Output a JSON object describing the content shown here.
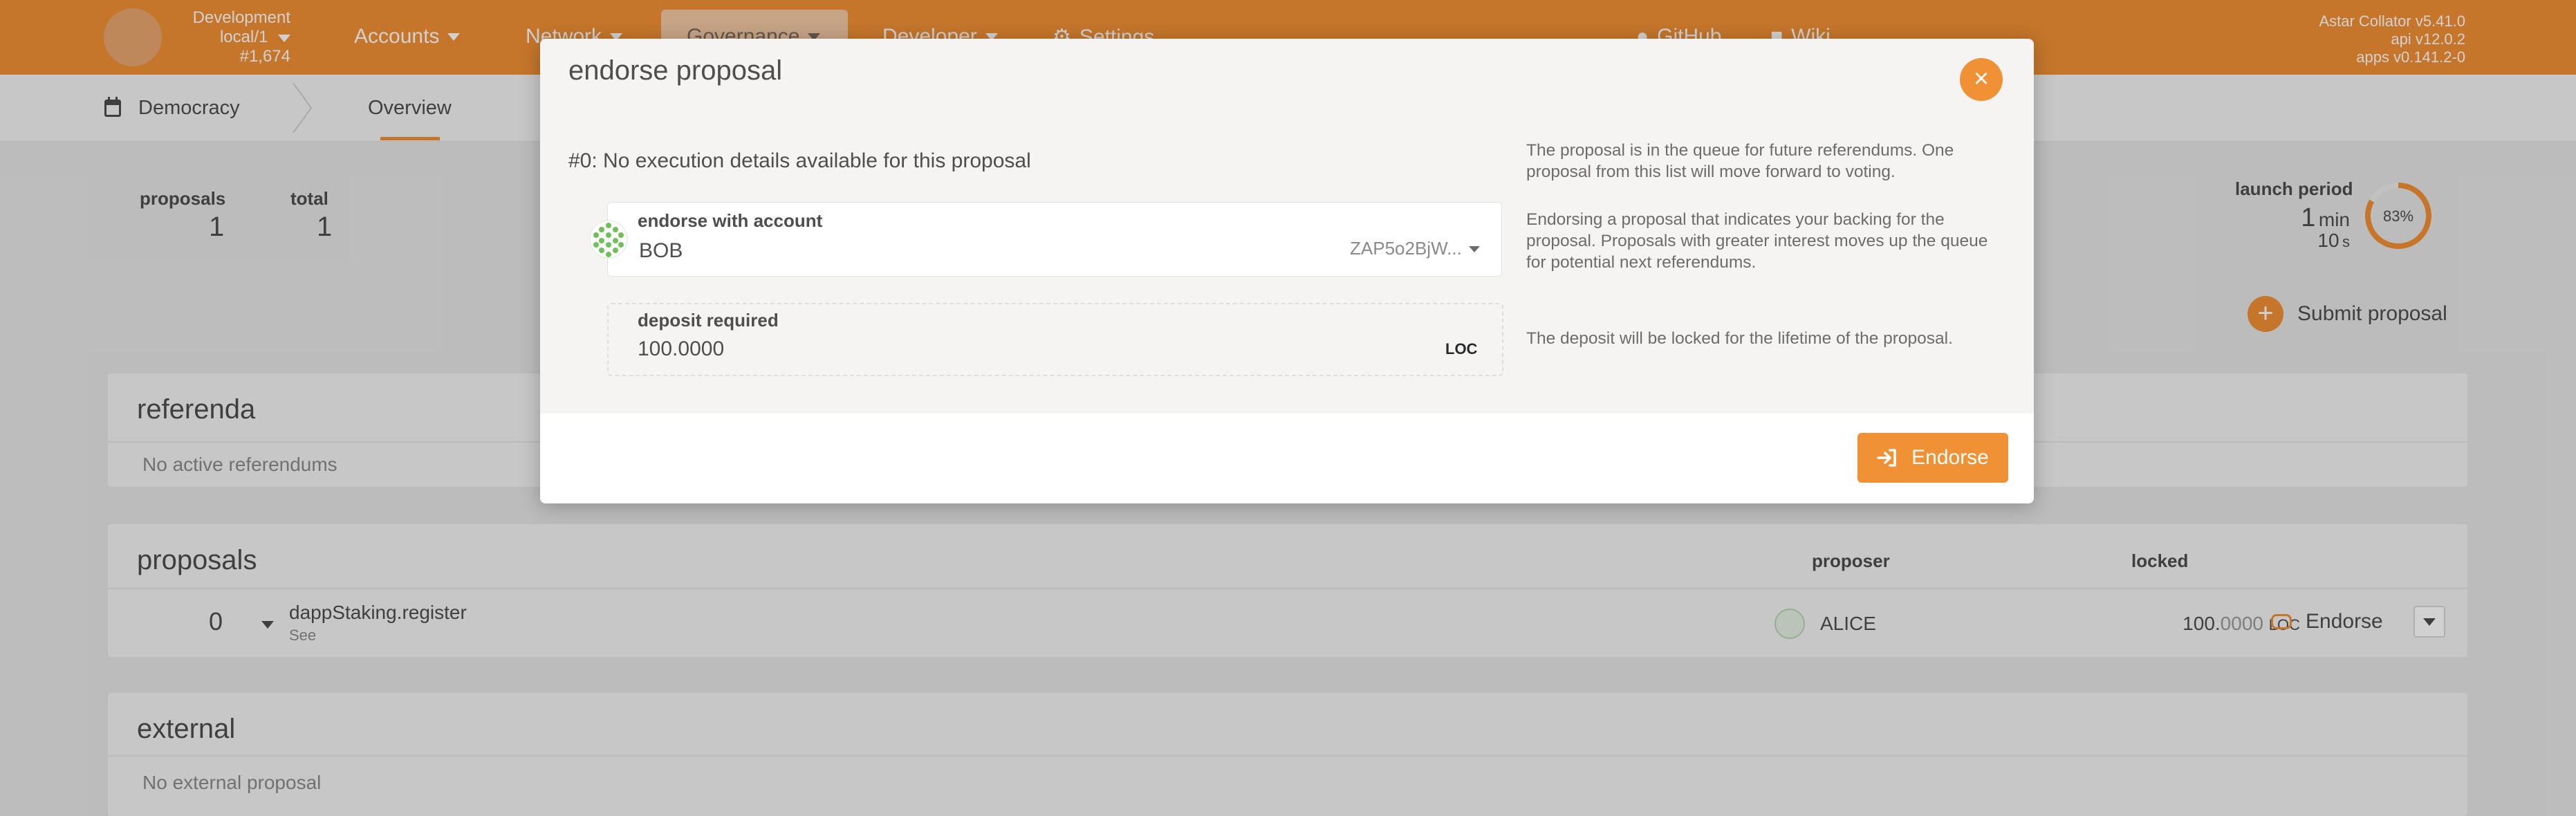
{
  "header": {
    "chain": {
      "name": "Development",
      "network": "local/1",
      "block": "#1,674"
    },
    "nav": [
      {
        "label": "Accounts"
      },
      {
        "label": "Network"
      },
      {
        "label": "Governance"
      },
      {
        "label": "Developer"
      },
      {
        "label": "Settings"
      }
    ],
    "links": [
      {
        "label": "GitHub"
      },
      {
        "label": "Wiki"
      }
    ],
    "version": {
      "collator": "Astar Collator v5.41.0",
      "api": "api v12.0.2",
      "apps": "apps v0.141.2-0"
    }
  },
  "subnav": {
    "section": "Democracy",
    "tab": "Overview"
  },
  "summary": {
    "proposals_label": "proposals",
    "proposals_value": "1",
    "total_label": "total",
    "total_value": "1",
    "launch_label": "launch period",
    "launch_min": "1",
    "launch_min_unit": "min",
    "launch_sec": "10",
    "launch_sec_unit": "s",
    "launch_percent": "83%",
    "launch_fraction": 0.83,
    "submit_label": "Submit proposal"
  },
  "referenda": {
    "title": "referenda",
    "empty": "No active referendums"
  },
  "proposals": {
    "title": "proposals",
    "headers": {
      "proposer": "proposer",
      "locked": "locked"
    },
    "rows": [
      {
        "index": "0",
        "call": "dappStaking.register",
        "see": "See",
        "proposer": "ALICE",
        "locked_int": "100.",
        "locked_dec": "0000",
        "locked_unit": "LOC",
        "action": "Endorse"
      }
    ]
  },
  "external": {
    "title": "external",
    "empty": "No external proposal"
  },
  "modal": {
    "title": "endorse proposal",
    "detail": "#0: No execution details available for this proposal",
    "help1": "The proposal is in the queue for future referendums. One proposal from this list will move forward to voting.",
    "help2": "Endorsing a proposal that indicates your backing for the proposal. Proposals with greater interest moves up the queue for potential next referendums.",
    "help3": "The deposit will be locked for the lifetime of the proposal.",
    "account": {
      "label": "endorse with account",
      "value": "BOB",
      "address": "ZAP5o2BjW..."
    },
    "deposit": {
      "label": "deposit required",
      "value": "100.0000",
      "unit": "LOC"
    },
    "endorse_button": "Endorse",
    "close": "×"
  },
  "colors": {
    "accent": "#f19135"
  }
}
